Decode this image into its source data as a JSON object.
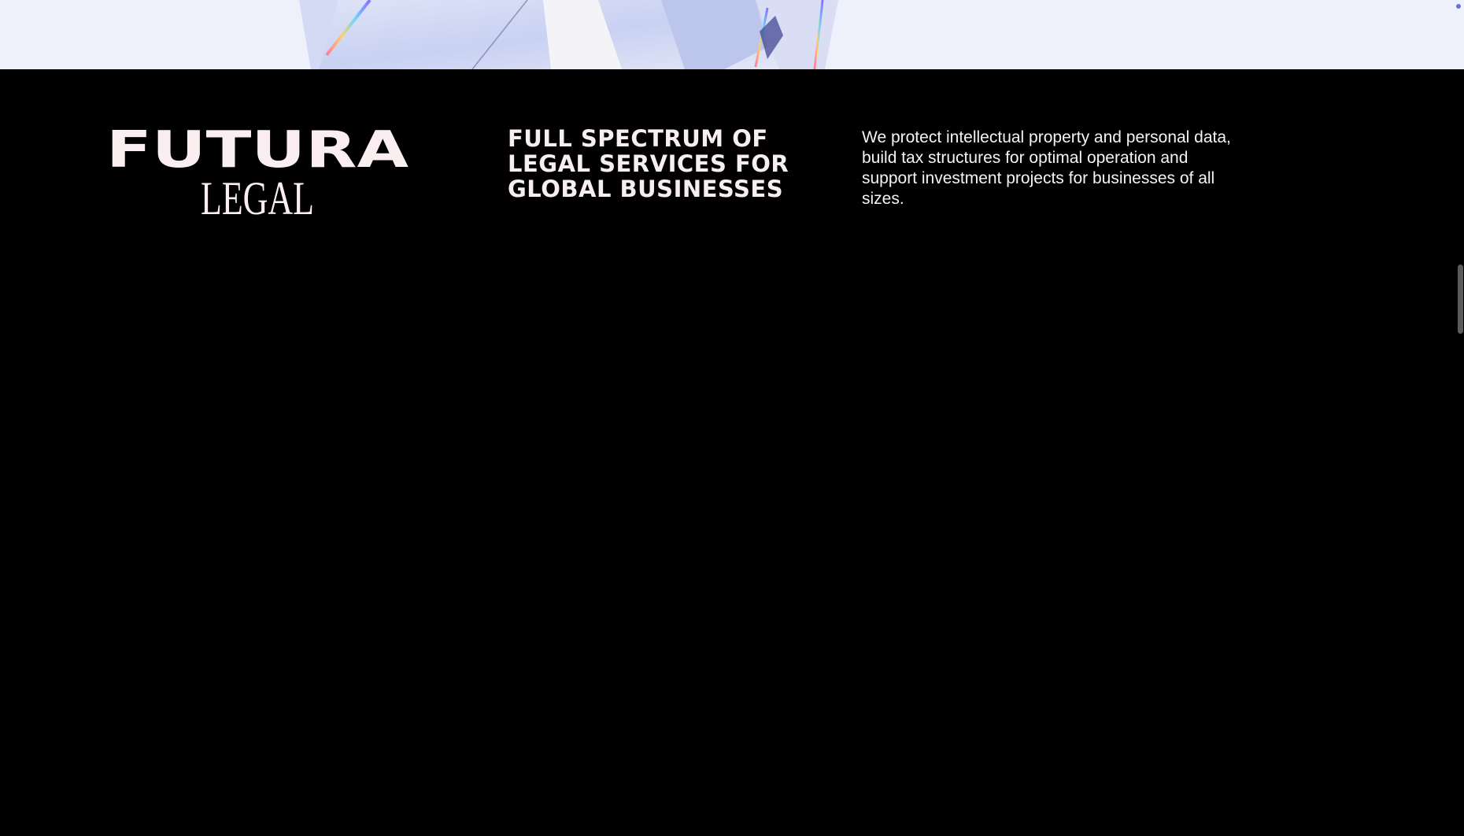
{
  "logo": {
    "primary": "FUTURA",
    "secondary": "LEGAL"
  },
  "footer": {
    "tagline": "FULL SPECTRUM OF LEGAL SERVICES FOR GLOBAL BUSINESSES",
    "description": "We protect intellectual property and personal data, build tax structures for optimal operation and support investment projects for businesses of all sizes."
  },
  "colors": {
    "background": "#000000",
    "hero_bg": "#eef1fb",
    "logo_text": "#fbeef0"
  },
  "icons": {
    "hero_graphic": "crystal-image"
  }
}
